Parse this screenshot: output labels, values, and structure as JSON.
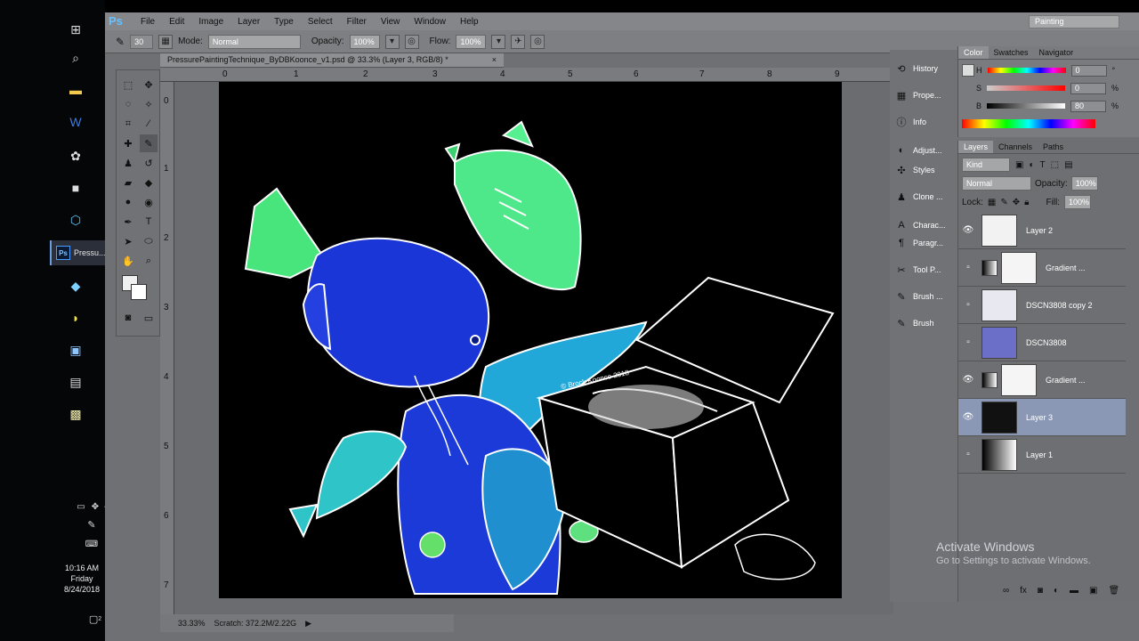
{
  "taskbar": {
    "task_label": "Pressu...",
    "time": "10:16 AM",
    "day": "Friday",
    "date": "8/24/2018",
    "badge": "2"
  },
  "menu": {
    "logo": "Ps",
    "items": [
      "File",
      "Edit",
      "Image",
      "Layer",
      "Type",
      "Select",
      "Filter",
      "View",
      "Window",
      "Help"
    ],
    "workspace": "Painting"
  },
  "options": {
    "brush_size": "30",
    "mode_label": "Mode:",
    "mode_value": "Normal",
    "opacity_label": "Opacity:",
    "opacity_value": "100%",
    "flow_label": "Flow:",
    "flow_value": "100%"
  },
  "document": {
    "tab_title": "PressurePaintingTechnique_ByDBKoonce_v1.psd @ 33.3% (Layer 3, RGB/8) *",
    "close": "×",
    "zoom": "33.33%",
    "scratch": "Scratch: 372.2M/2.22G",
    "ruler_top": [
      "0",
      "1",
      "2",
      "3",
      "4",
      "5",
      "6",
      "7",
      "8",
      "9"
    ],
    "ruler_left": [
      "0",
      "1",
      "2",
      "3",
      "4",
      "5",
      "6",
      "7"
    ],
    "signature": "© Brock Koonce 2018"
  },
  "panels": {
    "strip": [
      "History",
      "Prope...",
      "Info",
      "Adjust...",
      "Styles",
      "Clone ...",
      "Charac...",
      "Paragr...",
      "Tool P...",
      "Brush ...",
      "Brush"
    ]
  },
  "color": {
    "tabs": [
      "Color",
      "Swatches",
      "Navigator"
    ],
    "h_label": "H",
    "h_value": "0",
    "h_unit": "°",
    "s_label": "S",
    "s_value": "0",
    "s_unit": "%",
    "b_label": "B",
    "b_value": "80",
    "b_unit": "%"
  },
  "layers": {
    "tabs": [
      "Layers",
      "Channels",
      "Paths"
    ],
    "kind": "Kind",
    "blend": "Normal",
    "opacity_label": "Opacity:",
    "opacity_value": "100%",
    "lock_label": "Lock:",
    "fill_label": "Fill:",
    "fill_value": "100%",
    "items": [
      {
        "name": "Layer 2",
        "visible": true
      },
      {
        "name": "Gradient ...",
        "visible": false
      },
      {
        "name": "DSCN3808 copy 2",
        "visible": false
      },
      {
        "name": "DSCN3808",
        "visible": false
      },
      {
        "name": "Gradient ...",
        "visible": true
      },
      {
        "name": "Layer 3",
        "visible": true,
        "selected": true
      },
      {
        "name": "Layer 1",
        "visible": false
      }
    ]
  },
  "watermark": {
    "title": "Activate Windows",
    "subtitle": "Go to Settings to activate Windows."
  }
}
